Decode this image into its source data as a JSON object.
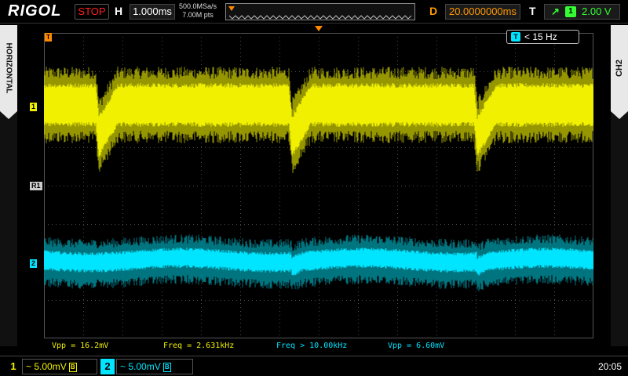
{
  "brand": {
    "logo": "RIGOL"
  },
  "header": {
    "run_state": "STOP",
    "h_label": "H",
    "timebase": "1.000ms",
    "sample_rate": "500.0MSa/s",
    "memory_depth": "7.00M pts",
    "d_label": "D",
    "delay": "20.0000000ms",
    "t_label": "T",
    "trigger_source": "1",
    "trigger_level": "2.00 V"
  },
  "side": {
    "left_tab": "HORIZONTAL",
    "right_tab": "CH2"
  },
  "markers": {
    "ch1": "1",
    "ref": "R1",
    "ch2": "2",
    "trigger_pos": "T"
  },
  "filter": {
    "icon": "T",
    "text": "< 15 Hz"
  },
  "measurements": [
    {
      "label": "Vpp = 16.2mV",
      "color": "#f0f000"
    },
    {
      "label": "Freq = 2.631kHz",
      "color": "#f0f000"
    },
    {
      "label": "Freq > 10.00kHz",
      "color": "#00e5ff"
    },
    {
      "label": "Vpp = 6.60mV",
      "color": "#00e5ff"
    }
  ],
  "channels": [
    {
      "number": "1",
      "scale": "~ 5.00mV",
      "color": "#f0f000",
      "bw_limit": "B"
    },
    {
      "number": "2",
      "scale": "~ 5.00mV",
      "color": "#00e5ff",
      "bw_limit": "B"
    }
  ],
  "clock": "20:05",
  "colors": {
    "ch1": "#f0f000",
    "ch2": "#00e5ff",
    "trigger": "#ff8800",
    "stop": "#ff2020",
    "trigger_level": "#33ff33"
  },
  "icons": {
    "trigger_edge": "rising-edge-icon",
    "trigger_position": "trigger-arrow-icon",
    "filter": "filter-icon"
  }
}
